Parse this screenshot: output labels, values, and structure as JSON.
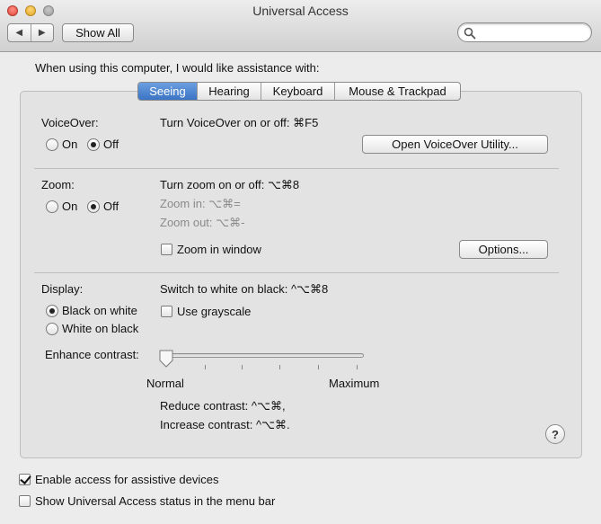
{
  "window": {
    "title": "Universal Access"
  },
  "toolbar": {
    "back_glyph": "◀",
    "forward_glyph": "▶",
    "show_all_label": "Show All",
    "search_placeholder": "",
    "search_value": ""
  },
  "intro_text": "When using this computer, I would like assistance with:",
  "tabs": [
    {
      "label": "Seeing",
      "active": true
    },
    {
      "label": "Hearing",
      "active": false
    },
    {
      "label": "Keyboard",
      "active": false
    },
    {
      "label": "Mouse & Trackpad",
      "active": false
    }
  ],
  "voiceover": {
    "label": "VoiceOver:",
    "on_label": "On",
    "off_label": "Off",
    "selected": "off",
    "shortcut_text": "Turn VoiceOver on or off: ⌘F5",
    "utility_button": "Open VoiceOver Utility..."
  },
  "zoom": {
    "label": "Zoom:",
    "on_label": "On",
    "off_label": "Off",
    "selected": "off",
    "shortcut_text": "Turn zoom on or off: ⌥⌘8",
    "zoom_in_text": "Zoom in: ⌥⌘=",
    "zoom_out_text": "Zoom out: ⌥⌘-",
    "zoom_in_window_label": "Zoom in window",
    "zoom_in_window_checked": false,
    "options_button": "Options..."
  },
  "display": {
    "label": "Display:",
    "black_on_white_label": "Black on white",
    "white_on_black_label": "White on black",
    "selected": "black_on_white",
    "switch_text": "Switch to white on black: ^⌥⌘8",
    "grayscale_label": "Use grayscale",
    "grayscale_checked": false,
    "enhance_contrast_label": "Enhance contrast:",
    "contrast_level": 0,
    "min_label": "Normal",
    "max_label": "Maximum",
    "reduce_text": "Reduce contrast: ^⌥⌘,",
    "increase_text": "Increase contrast: ^⌥⌘."
  },
  "help_glyph": "?",
  "footer": {
    "assistive_label": "Enable access for assistive devices",
    "assistive_checked": true,
    "menubar_label": "Show Universal Access status in the menu bar",
    "menubar_checked": false
  },
  "colors": {
    "tab_active": "#3b74c5",
    "close": "#e0453a",
    "minimize": "#e0a623"
  }
}
